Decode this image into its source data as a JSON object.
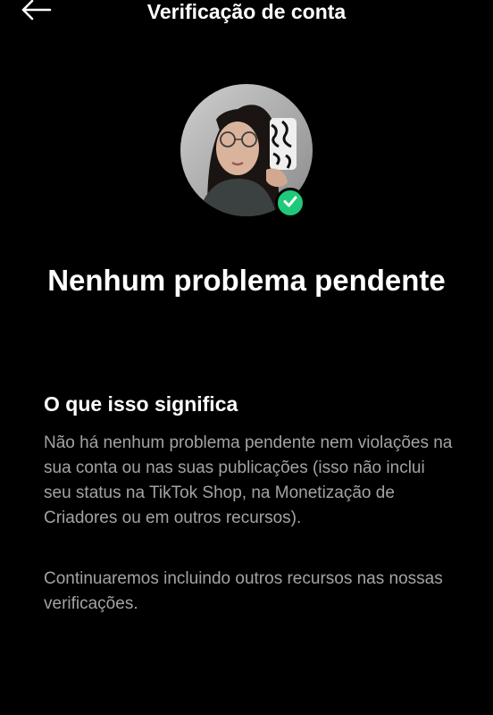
{
  "header": {
    "title": "Verificação de conta",
    "back_icon": "arrow-left-icon"
  },
  "profile": {
    "avatar_alt": "Foto de perfil",
    "badge_icon": "checkmark-icon",
    "badge_color": "#1fc97a"
  },
  "status": {
    "headline": "Nenhum problema pendente"
  },
  "info": {
    "title": "O que isso significa",
    "paragraph1": "Não há nenhum problema pendente nem violações na sua conta ou nas suas publicações (isso não inclui seu status na TikTok Shop, na Monetização de Criadores ou em outros recursos).",
    "paragraph2": "Continuaremos incluindo outros recursos nas nossas verificações."
  },
  "colors": {
    "background": "#000000",
    "text_primary": "#ffffff",
    "text_secondary": "#a3a3a3",
    "accent": "#1fc97a"
  }
}
